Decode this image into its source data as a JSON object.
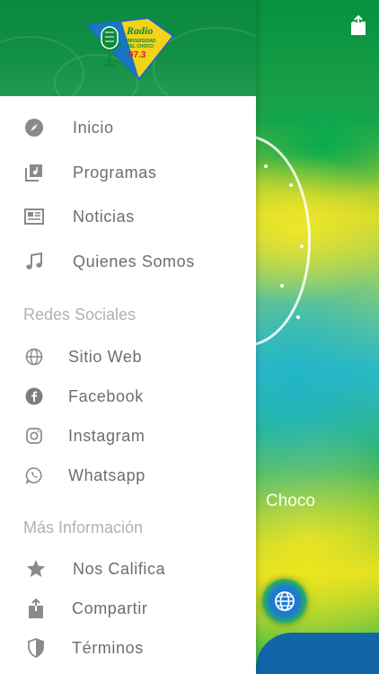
{
  "background": {
    "visible_text": "Choco",
    "share_icon": "share-icon",
    "globe_icon": "globe-icon"
  },
  "drawer": {
    "header": {
      "logo_lines": [
        "Radio",
        "UNIVERSIDAD",
        "DEL CHOCO",
        "97.3"
      ],
      "logo_icon": "microphone-logo"
    },
    "main_items": [
      {
        "label": "Inicio",
        "icon": "compass-icon"
      },
      {
        "label": "Programas",
        "icon": "media-library-icon"
      },
      {
        "label": "Noticias",
        "icon": "newspaper-icon"
      },
      {
        "label": "Quienes Somos",
        "icon": "music-note-icon"
      }
    ],
    "social_section_title": "Redes Sociales",
    "social_items": [
      {
        "label": "Sitio Web",
        "icon": "globe-icon"
      },
      {
        "label": "Facebook",
        "icon": "facebook-icon"
      },
      {
        "label": "Instagram",
        "icon": "instagram-icon"
      },
      {
        "label": "Whatsapp",
        "icon": "whatsapp-icon"
      }
    ],
    "info_section_title": "Más Información",
    "info_items": [
      {
        "label": "Nos Califica",
        "icon": "star-icon"
      },
      {
        "label": "Compartir",
        "icon": "share-icon"
      },
      {
        "label": "Términos",
        "icon": "shield-icon"
      }
    ]
  },
  "colors": {
    "header_green": "#0b8a3f",
    "label_gray": "#6d6d6d",
    "section_gray": "#b1b1b1",
    "icon_gray": "#8a8a8a"
  }
}
